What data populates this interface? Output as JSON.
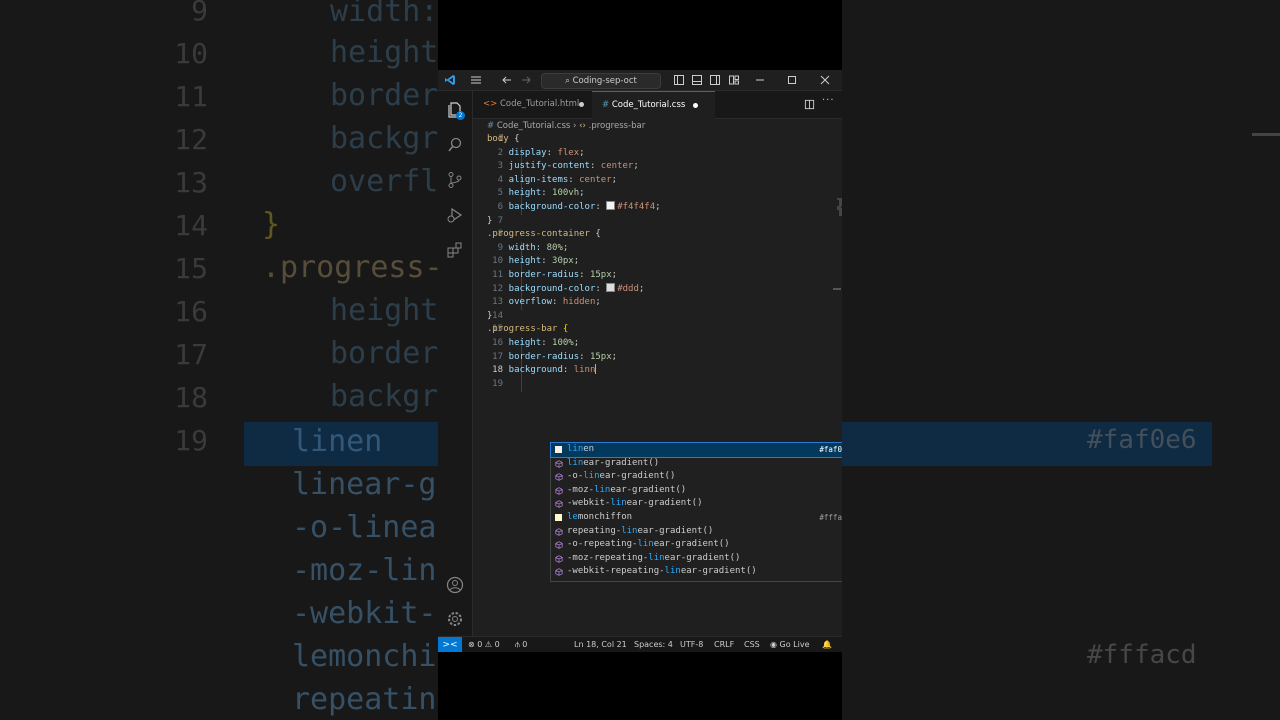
{
  "window": {
    "search_text": "Coding-sep-oct"
  },
  "tabs": [
    {
      "label": "Code_Tutorial.html",
      "icon": "html-file-icon",
      "active": false,
      "modified": true
    },
    {
      "label": "Code_Tutorial.css",
      "icon": "css-file-icon",
      "active": true,
      "modified": true
    }
  ],
  "breadcrumb": {
    "file": "Code_Tutorial.css",
    "symbol": ".progress-bar"
  },
  "explorer_badge": "2",
  "lines": [
    {
      "n": "1",
      "parts": [
        [
          "sel",
          "body "
        ],
        [
          "pn",
          "{"
        ]
      ]
    },
    {
      "n": "2",
      "parts": [
        [
          "prop",
          "    display"
        ],
        [
          "pn",
          ": "
        ],
        [
          "val",
          "flex"
        ],
        [
          "pn",
          ";"
        ]
      ]
    },
    {
      "n": "3",
      "parts": [
        [
          "prop",
          "    justify-content"
        ],
        [
          "pn",
          ": "
        ],
        [
          "val",
          "center"
        ],
        [
          "pn",
          ";"
        ]
      ]
    },
    {
      "n": "4",
      "parts": [
        [
          "prop",
          "    align-items"
        ],
        [
          "pn",
          ": "
        ],
        [
          "val",
          "center"
        ],
        [
          "pn",
          ";"
        ]
      ]
    },
    {
      "n": "5",
      "parts": [
        [
          "prop",
          "    height"
        ],
        [
          "pn",
          ": "
        ],
        [
          "num",
          "100vh"
        ],
        [
          "pn",
          ";"
        ]
      ]
    },
    {
      "n": "6",
      "parts": [
        [
          "prop",
          "    background-color"
        ],
        [
          "pn",
          ": "
        ],
        [
          "swatch",
          "#f4f4f4"
        ],
        [
          "val",
          "#f4f4f4"
        ],
        [
          "pn",
          ";"
        ]
      ]
    },
    {
      "n": "7",
      "parts": [
        [
          "pn",
          "}"
        ]
      ]
    },
    {
      "n": "8",
      "parts": [
        [
          "sel",
          ".progress-container "
        ],
        [
          "pn",
          "{"
        ]
      ]
    },
    {
      "n": "9",
      "parts": [
        [
          "prop",
          "    width"
        ],
        [
          "pn",
          ": "
        ],
        [
          "num",
          "80%"
        ],
        [
          "pn",
          ";"
        ]
      ]
    },
    {
      "n": "10",
      "parts": [
        [
          "prop",
          "    height"
        ],
        [
          "pn",
          ": "
        ],
        [
          "num",
          "30px"
        ],
        [
          "pn",
          ";"
        ]
      ]
    },
    {
      "n": "11",
      "parts": [
        [
          "prop",
          "    border-radius"
        ],
        [
          "pn",
          ": "
        ],
        [
          "num",
          "15px"
        ],
        [
          "pn",
          ";"
        ]
      ]
    },
    {
      "n": "12",
      "parts": [
        [
          "prop",
          "    background-color"
        ],
        [
          "pn",
          ": "
        ],
        [
          "swatch",
          "#dddddd"
        ],
        [
          "val",
          "#ddd"
        ],
        [
          "pn",
          ";"
        ]
      ]
    },
    {
      "n": "13",
      "parts": [
        [
          "prop",
          "    overflow"
        ],
        [
          "pn",
          ": "
        ],
        [
          "val",
          "hidden"
        ],
        [
          "pn",
          ";"
        ]
      ]
    },
    {
      "n": "14",
      "parts": [
        [
          "pn",
          "}"
        ]
      ]
    },
    {
      "n": "15",
      "parts": [
        [
          "sel",
          ".progress-bar "
        ],
        [
          "br",
          "{"
        ]
      ]
    },
    {
      "n": "16",
      "parts": [
        [
          "prop",
          "    height"
        ],
        [
          "pn",
          ": "
        ],
        [
          "num",
          "100%"
        ],
        [
          "pn",
          ";"
        ]
      ]
    },
    {
      "n": "17",
      "parts": [
        [
          "prop",
          "    border-radius"
        ],
        [
          "pn",
          ": "
        ],
        [
          "num",
          "15px"
        ],
        [
          "pn",
          ";"
        ]
      ]
    },
    {
      "n": "18",
      "parts": [
        [
          "prop",
          "    background"
        ],
        [
          "pn",
          ": "
        ],
        [
          "val",
          "linn"
        ],
        [
          "cursor",
          ""
        ]
      ]
    },
    {
      "n": "19",
      "parts": []
    }
  ],
  "current_line": "18",
  "suggestions": [
    {
      "pre": "",
      "hl": "lin",
      "post": "en",
      "kind": "color",
      "swatch": "#faf0e6",
      "detail": "#faf0e6",
      "active": true
    },
    {
      "pre": "",
      "hl": "lin",
      "post": "ear-gradient()",
      "kind": "function",
      "detail": ""
    },
    {
      "pre": "-o-",
      "hl": "lin",
      "post": "ear-gradient()",
      "kind": "function",
      "detail": ""
    },
    {
      "pre": "-moz-",
      "hl": "lin",
      "post": "ear-gradient()",
      "kind": "function",
      "detail": ""
    },
    {
      "pre": "-webkit-",
      "hl": "lin",
      "post": "ear-gradient()",
      "kind": "function",
      "detail": ""
    },
    {
      "pre": "",
      "hl": "le",
      "post": "monchiffon",
      "kind": "color",
      "swatch": "#fffacd",
      "detail": "#fffacd"
    },
    {
      "pre": "repeating-",
      "hl": "lin",
      "post": "ear-gradient()",
      "kind": "function",
      "detail": ""
    },
    {
      "pre": "-o-repeating-",
      "hl": "lin",
      "post": "ear-gradient()",
      "kind": "function",
      "detail": ""
    },
    {
      "pre": "-moz-repeating-",
      "hl": "lin",
      "post": "ear-gradient()",
      "kind": "function",
      "detail": ""
    },
    {
      "pre": "-webkit-repeating-",
      "hl": "lin",
      "post": "ear-gradient()",
      "kind": "function",
      "detail": ""
    }
  ],
  "status": {
    "errors": "0",
    "warnings": "0",
    "ports": "0",
    "position": "Ln 18, Col 21",
    "spaces": "Spaces: 4",
    "encoding": "UTF-8",
    "eol": "CRLF",
    "language": "CSS",
    "golive": "Go Live"
  },
  "backdrop": {
    "left_lines": [
      "width:",
      "height",
      "border",
      "backgr",
      "overfl",
      "}",
      ".progress-",
      "height",
      "border",
      "backgr"
    ],
    "left_numbers": [
      "9",
      "10",
      "11",
      "12",
      "13",
      "14",
      "15",
      "16",
      "17",
      "18",
      "19"
    ],
    "suggest_left": [
      "linen",
      "linear-gr",
      "-o-linear",
      "-moz-line",
      "-webkit-",
      "lemonchi",
      "repeating"
    ],
    "right_detail_1": "#faf0e6",
    "right_detail_2": "#fffacd"
  },
  "colors": {
    "accent": "#0078d4",
    "selector": "#d7ba7d",
    "property": "#9cdcfe",
    "value": "#ce9178",
    "number": "#b5cea8",
    "match": "#2aaaff"
  }
}
